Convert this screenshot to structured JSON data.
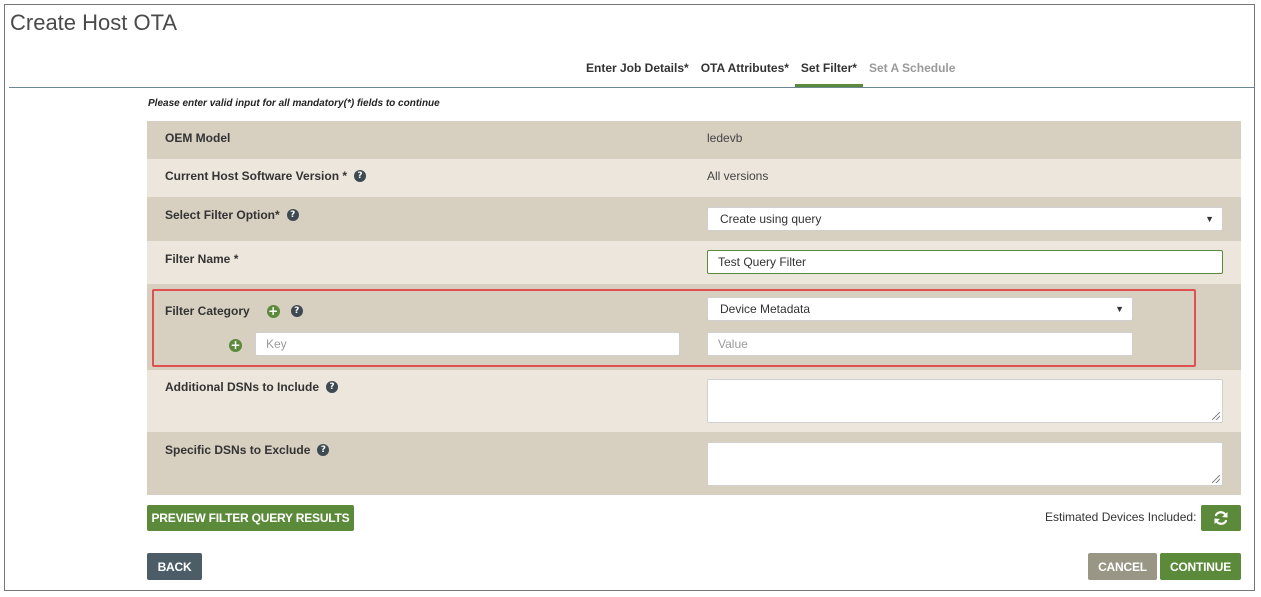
{
  "page": {
    "title": "Create Host OTA"
  },
  "tabs": [
    {
      "label": "Enter Job Details*",
      "state": "done"
    },
    {
      "label": "OTA Attributes*",
      "state": "done"
    },
    {
      "label": "Set Filter*",
      "state": "active"
    },
    {
      "label": "Set A Schedule",
      "state": "disabled"
    }
  ],
  "notice": "Please enter valid input for all mandatory(*) fields to continue",
  "form": {
    "oem_model": {
      "label": "OEM Model",
      "value": "ledevb"
    },
    "host_version": {
      "label": "Current Host Software Version *",
      "value": "All versions"
    },
    "filter_option": {
      "label": "Select Filter Option*",
      "selected": "Create using query"
    },
    "filter_name": {
      "label": "Filter Name *",
      "value": "Test Query Filter"
    },
    "filter_category": {
      "label": "Filter Category",
      "selected": "Device Metadata",
      "key_placeholder": "Key",
      "value_placeholder": "Value"
    },
    "include_dsns": {
      "label": "Additional DSNs to Include"
    },
    "exclude_dsns": {
      "label": "Specific DSNs to Exclude"
    }
  },
  "actions": {
    "preview": "PREVIEW FILTER QUERY RESULTS",
    "estimated_label": "Estimated Devices Included:",
    "back": "BACK",
    "cancel": "CANCEL",
    "continue": "CONTINUE"
  },
  "icons": {
    "help": "question-circle-icon",
    "add": "plus-circle-icon",
    "refresh": "refresh-icon",
    "dropdown": "chevron-down-icon"
  },
  "colors": {
    "accent": "#5a8a3a",
    "row_dark": "#d7cfc0",
    "row_light": "#ede6dc",
    "highlight": "#e05050",
    "back_button": "#4d5d68",
    "cancel_button": "#9a9685"
  }
}
